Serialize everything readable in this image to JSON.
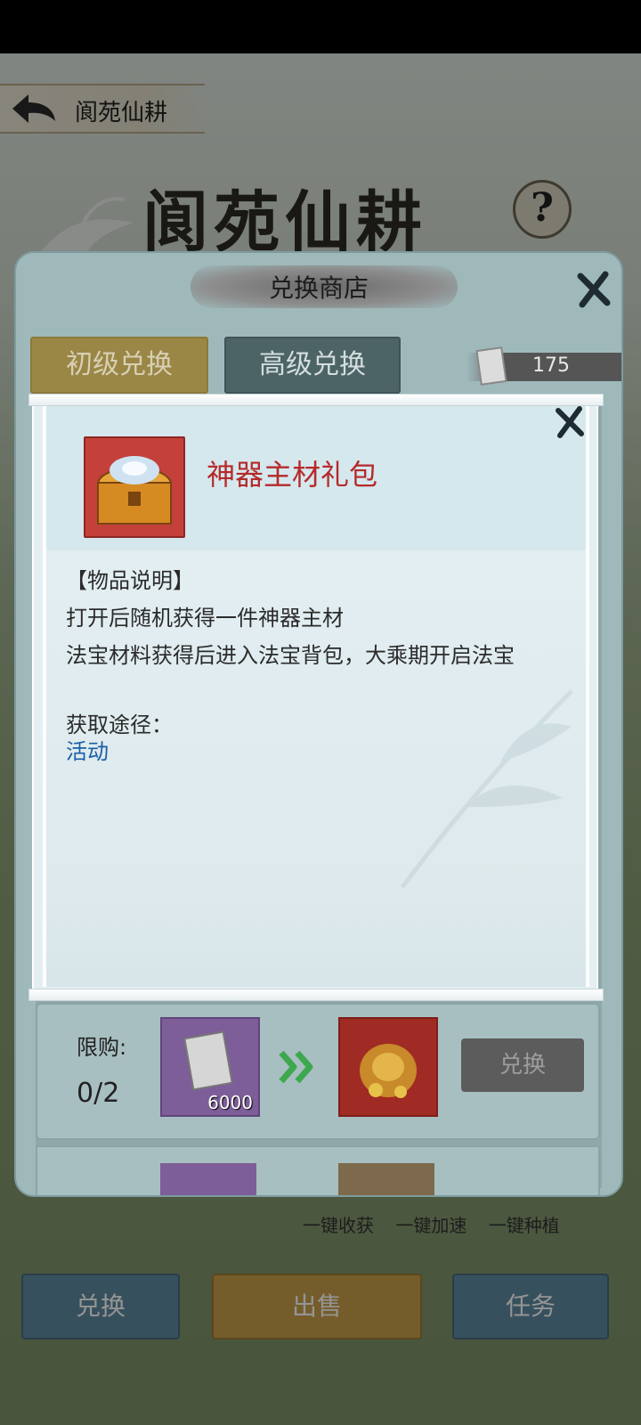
{
  "header": {
    "nav_title": "阆苑仙耕",
    "page_title": "阆苑仙耕",
    "help_glyph": "?"
  },
  "shop": {
    "title": "兑换商店",
    "tabs": [
      {
        "label": "初级兑换",
        "active": true
      },
      {
        "label": "高级兑换",
        "active": false
      }
    ],
    "currency_amount": "175"
  },
  "item_row": {
    "limit_label": "限购:",
    "limit_count": "0/2",
    "cost_amount": "6000",
    "cost_icon_text": "银契",
    "redeem_label": "兑换"
  },
  "tooltip": {
    "item_name": "神器主材礼包",
    "desc_header": "【物品说明】",
    "desc_lines": [
      "打开后随机获得一件神器主材",
      "法宝材料获得后进入法宝背包，大乘期开启法宝"
    ],
    "source_label": "获取途径：",
    "source_link": "活动"
  },
  "footer": {
    "quick_actions": "一键收获 一键加速 一键种植",
    "buttons": [
      "兑换",
      "出售",
      "任务"
    ]
  },
  "colors": {
    "item_name": "#b52a2a",
    "source_link": "#1a5ea8",
    "active_tab": "#9a8746",
    "inactive_tab": "#4d6466"
  }
}
